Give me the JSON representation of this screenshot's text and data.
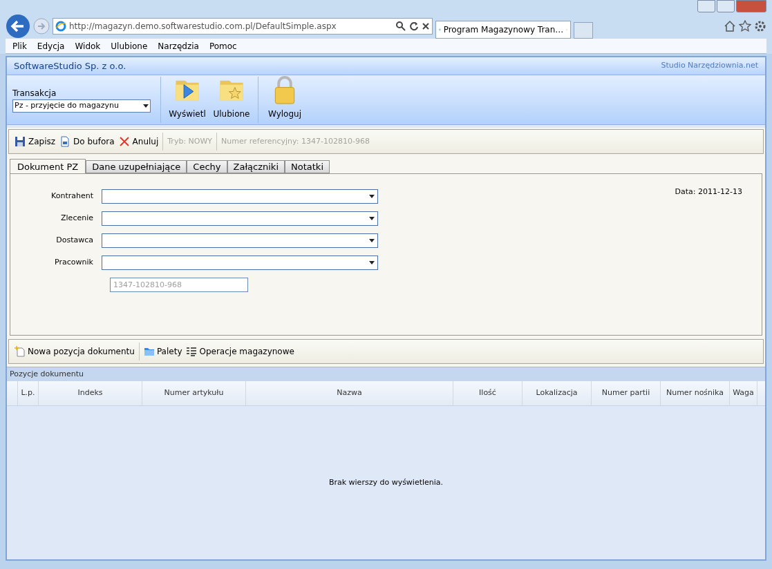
{
  "browser": {
    "address": "http://magazyn.demo.softwarestudio.com.pl/DefaultSimple.aspx",
    "tab_title": "Program Magazynowy Tran…",
    "menu": [
      "Plik",
      "Edycja",
      "Widok",
      "Ulubione",
      "Narzędzia",
      "Pomoc"
    ]
  },
  "header": {
    "company": "SoftwareStudio Sp. z o.o.",
    "brand": "Studio Narzędziownia.net"
  },
  "ribbon": {
    "transaction_label": "Transakcja",
    "transaction_value": "Pz - przyjęcie do magazynu",
    "buttons": [
      {
        "kind": "show",
        "label": "Wyświetl"
      },
      {
        "kind": "favorites",
        "label": "Ulubione"
      },
      {
        "kind": "logout",
        "label": "Wyloguj"
      }
    ]
  },
  "toolbar": {
    "buttons": [
      {
        "kind": "save",
        "label": "Zapisz"
      },
      {
        "kind": "buffer",
        "label": "Do bufora"
      },
      {
        "kind": "cancel",
        "label": "Anuluj"
      }
    ],
    "mode": "Tryb: NOWY",
    "reference": "Numer referencyjny: 1347-102810-968"
  },
  "tabs": [
    {
      "label": "Dokument PZ",
      "selected": true
    },
    {
      "label": "Dane uzupełniające",
      "selected": false
    },
    {
      "label": "Cechy",
      "selected": false
    },
    {
      "label": "Załączniki",
      "selected": false
    },
    {
      "label": "Notatki",
      "selected": false
    }
  ],
  "form": {
    "fields": [
      {
        "label": "Kontrahent"
      },
      {
        "label": "Zlecenie"
      },
      {
        "label": "Dostawca"
      },
      {
        "label": "Pracownik"
      }
    ],
    "reference_field": {
      "placeholder": "1347-102810-968"
    },
    "date": "Data: 2011-12-13"
  },
  "items_toolbar": {
    "buttons": [
      {
        "kind": "new",
        "label": "Nowa pozycja dokumentu"
      },
      {
        "kind": "pallets",
        "label": "Palety"
      },
      {
        "kind": "operations",
        "label": "Operacje magazynowe"
      }
    ]
  },
  "table": {
    "title": "Pozycje dokumentu",
    "columns": [
      "L.p.",
      "Indeks",
      "Numer artykułu",
      "Nazwa",
      "Ilość",
      "Lokalizacja",
      "Numer partii",
      "Numer nośnika",
      "Waga"
    ],
    "empty_message": "Brak wierszy do wyświetlenia."
  }
}
